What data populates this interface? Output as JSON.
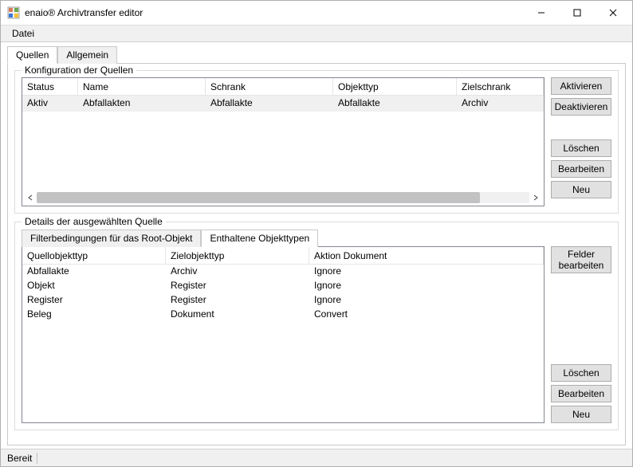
{
  "window": {
    "title": "enaio® Archivtransfer editor"
  },
  "menu": {
    "file": "Datei"
  },
  "mainTabs": {
    "sources": "Quellen",
    "general": "Allgemein"
  },
  "sourcesGroup": {
    "title": "Konfiguration der Quellen",
    "columns": {
      "status": "Status",
      "name": "Name",
      "schrank": "Schrank",
      "objekttyp": "Objekttyp",
      "zielschrank": "Zielschrank"
    },
    "rows": [
      {
        "status": "Aktiv",
        "name": "Abfallakten",
        "schrank": "Abfallakte",
        "objekttyp": "Abfallakte",
        "zielschrank": "Archiv"
      }
    ],
    "buttons": {
      "activate": "Aktivieren",
      "deactivate": "Deaktivieren",
      "delete": "Löschen",
      "edit": "Bearbeiten",
      "new": "Neu"
    }
  },
  "detailsGroup": {
    "title": "Details der ausgewählten Quelle",
    "subTabs": {
      "filter": "Filterbedingungen für das Root-Objekt",
      "contained": "Enthaltene Objekttypen"
    },
    "columns": {
      "quell": "Quellobjekttyp",
      "ziel": "Zielobjekttyp",
      "aktion": "Aktion Dokument"
    },
    "rows": [
      {
        "quell": "Abfallakte",
        "ziel": "Archiv",
        "aktion": "Ignore"
      },
      {
        "quell": "Objekt",
        "ziel": "Register",
        "aktion": "Ignore"
      },
      {
        "quell": "Register",
        "ziel": "Register",
        "aktion": "Ignore"
      },
      {
        "quell": "Beleg",
        "ziel": "Dokument",
        "aktion": "Convert"
      }
    ],
    "buttons": {
      "editFields": "Felder bearbeiten",
      "delete": "Löschen",
      "edit": "Bearbeiten",
      "new": "Neu"
    }
  },
  "statusbar": {
    "ready": "Bereit"
  }
}
